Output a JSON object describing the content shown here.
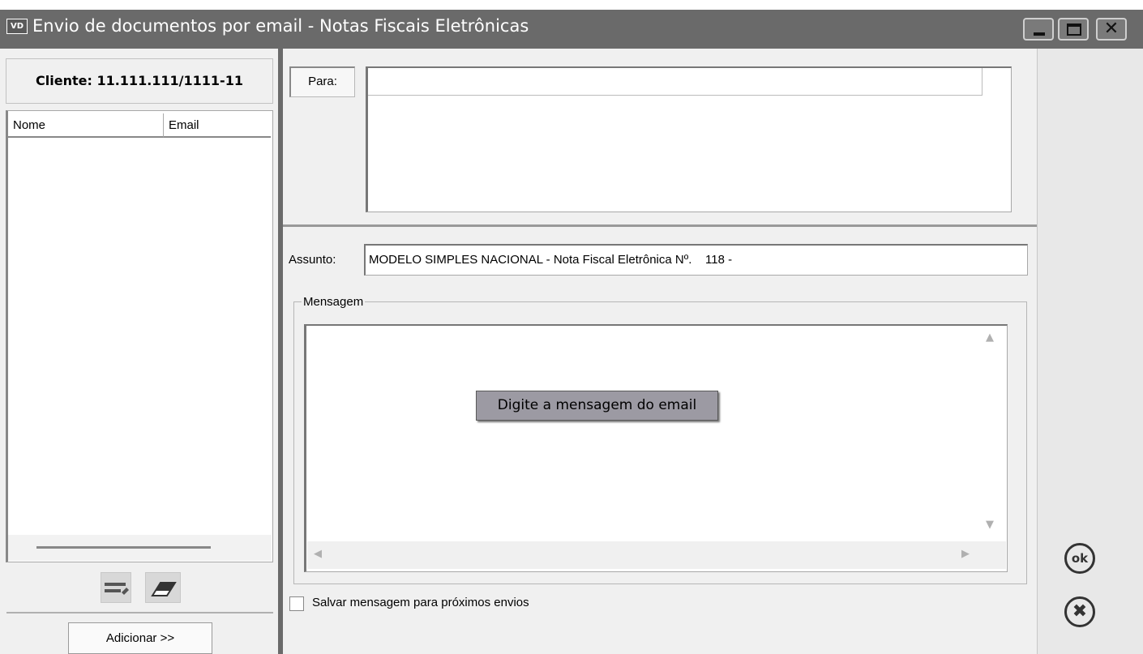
{
  "window": {
    "app_icon": "VD",
    "title": "Envio de documentos por email - Notas Fiscais Eletrônicas",
    "controls": [
      "minimize-icon",
      "maximize-icon",
      "close-icon"
    ]
  },
  "left_panel": {
    "client_label": "Cliente: 11.111.111/1111-11",
    "columns": [
      "Nome",
      "Email"
    ],
    "rows": [],
    "add_button": "Adicionar >>",
    "icons": [
      "edit-list-icon",
      "eraser-icon"
    ]
  },
  "form": {
    "para_label": "Para:",
    "para_value": "",
    "assunto_label": "Assunto:",
    "assunto_value": "MODELO SIMPLES NACIONAL - Nota Fiscal Eletrônica Nº.    118 -",
    "mensagem_label": "Mensagem",
    "mensagem_value": "",
    "tooltip": "Digite a mensagem do email",
    "save_checkbox_label": "Salvar mensagem para próximos envios",
    "save_checkbox_checked": false
  },
  "actions": {
    "ok_label": "ok",
    "cancel_icon": "cancel-icon"
  }
}
